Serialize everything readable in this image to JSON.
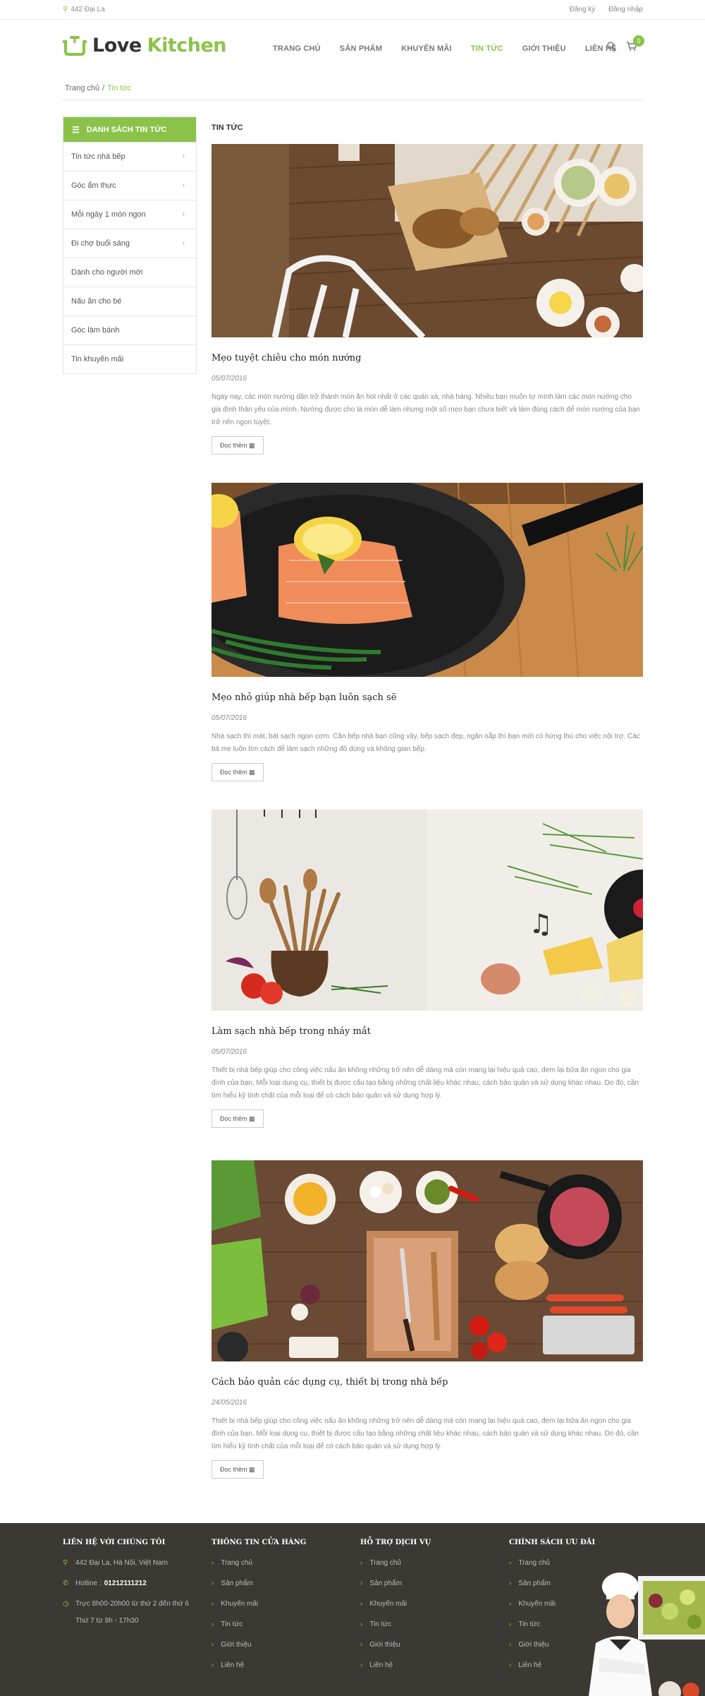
{
  "topbar": {
    "address": "442 Đại La",
    "register": "Đăng ký",
    "login": "Đăng nhập"
  },
  "logo": {
    "word1": "Love",
    "word2": "Kitchen"
  },
  "nav": [
    "TRANG CHỦ",
    "SẢN PHẨM",
    "KHUYẾN MÃI",
    "TIN TỨC",
    "GIỚI THIỆU",
    "LIÊN HỆ"
  ],
  "nav_active_index": 3,
  "cart_count": "0",
  "breadcrumb": {
    "home": "Trang chủ",
    "sep": "/",
    "current": "Tin tức"
  },
  "sidebar": {
    "title": "DANH SÁCH TIN TỨC",
    "items": [
      {
        "label": "Tin tức nhà bếp",
        "has_chevron": true
      },
      {
        "label": "Góc ẩm thực",
        "has_chevron": true
      },
      {
        "label": "Mỗi ngày 1 món ngon",
        "has_chevron": true
      },
      {
        "label": "Đi chợ buổi sáng",
        "has_chevron": true
      },
      {
        "label": "Dành cho người mới",
        "has_chevron": false
      },
      {
        "label": "Nấu ăn cho bé",
        "has_chevron": false
      },
      {
        "label": "Góc làm bánh",
        "has_chevron": false
      },
      {
        "label": "Tin khuyến mãi",
        "has_chevron": false
      }
    ]
  },
  "section_title": "TIN TỨC",
  "posts": [
    {
      "title": "Mẹo tuyệt chiêu cho món nướng",
      "date": "05/07/2016",
      "excerpt": "Ngày nay, các món nướng dần trở thành món ăn hot nhất ở các quán xá, nhà hàng. Nhiều bạn muốn tự mình làm các món nướng cho gia đình thân yêu của mình. Nướng được cho là món dễ làm nhưng một số mẹo bạn chưa biết và làm đúng cách để món nướng của bạn trở nên ngon tuyệt.",
      "more": "Đọc thêm"
    },
    {
      "title": "Mẹo nhỏ giúp nhà bếp bạn luôn sạch sẽ",
      "date": "05/07/2016",
      "excerpt": "Nhà sạch thì mát, bát sạch ngon cơm. Căn bếp nhà bạn cũng vậy, bếp sạch đẹp, ngăn nắp thì bạn mới có hứng thú cho việc nội trợ. Các bà mẹ luôn tìm cách để làm sạch những đồ dùng và không gian bếp.",
      "more": "Đọc thêm"
    },
    {
      "title": "Làm sạch nhà bếp trong nháy mắt",
      "date": "05/07/2016",
      "excerpt": "Thiết bị nhà bếp giúp cho công việc nấu ăn không những trở nên dễ dàng mà còn mang lại hiệu quả cao, đem lại bữa ăn ngon cho gia đình của bạn. Mỗi loại dụng cụ, thiết bị được cấu tạo bằng những chất liệu khác nhau, cách bảo quản và sử dụng khác nhau. Do đó, cần tìm hiểu kỹ tính chất của mỗi loại để có cách bảo quản và sử dụng hợp lý.",
      "more": "Đọc thêm"
    },
    {
      "title": "Cách bảo quản các dụng cụ, thiết bị trong nhà bếp",
      "date": "24/05/2016",
      "excerpt": "Thiết bị nhà bếp giúp cho công việc nấu ăn không những trở nên dễ dàng mà còn mang lại hiệu quả cao, đem lại bữa ăn ngon cho gia đình của bạn. Mỗi loại dụng cụ, thiết bị được cấu tạo bằng những chất liệu khác nhau, cách bảo quản và sử dụng khác nhau. Do đó, cần tìm hiểu kỹ tính chất của mỗi loại để có cách bảo quản và sử dụng hợp lý.",
      "more": "Đọc thêm"
    }
  ],
  "footer": {
    "contact": {
      "title": "LIÊN HỆ VỚI CHÚNG TÔI",
      "address": "442 Đại La, Hà Nội, Việt Nam",
      "hotline_label": "Hotline :",
      "hotline": "01212111212",
      "hours1": "Trực 8h00-20h00 từ thứ 2 đến thứ 6",
      "hours2": "Thứ 7 từ 8h - 17h30"
    },
    "store": {
      "title": "THÔNG TIN CỬA HÀNG",
      "links": [
        "Trang chủ",
        "Sản phẩm",
        "Khuyến mãi",
        "Tin tức",
        "Giới thiệu",
        "Liên hệ"
      ]
    },
    "support": {
      "title": "HỖ TRỢ DỊCH VỤ",
      "links": [
        "Trang chủ",
        "Sản phẩm",
        "Khuyến mãi",
        "Tin tức",
        "Giới thiệu",
        "Liên hệ"
      ]
    },
    "policy": {
      "title": "CHÍNH SÁCH ƯU ĐÃI",
      "links": [
        "Trang chủ",
        "Sản phẩm",
        "Khuyến mãi",
        "Tin tức",
        "Giới thiệu",
        "Liên hệ"
      ]
    }
  },
  "colors": {
    "accent": "#8bc34a",
    "footer_bg": "#3c3834"
  }
}
